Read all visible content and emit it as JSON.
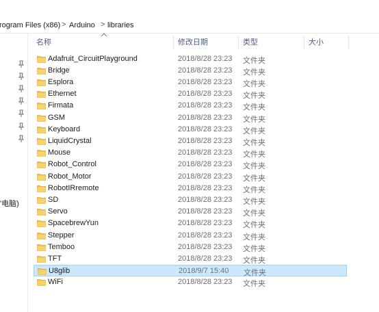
{
  "address": {
    "crumbs": [
      "rogram Files (x86)",
      "Arduino",
      "libraries"
    ],
    "separator": ">"
  },
  "nav": {
    "pins": 7,
    "partial_label": "'电脑)"
  },
  "columns": {
    "name": "名称",
    "modified": "修改日期",
    "type": "类型",
    "size": "大小"
  },
  "files": [
    {
      "name": "Adafruit_CircuitPlayground",
      "modified": "2018/8/28 23:23",
      "type": "文件夹"
    },
    {
      "name": "Bridge",
      "modified": "2018/8/28 23:23",
      "type": "文件夹"
    },
    {
      "name": "Esplora",
      "modified": "2018/8/28 23:23",
      "type": "文件夹"
    },
    {
      "name": "Ethernet",
      "modified": "2018/8/28 23:23",
      "type": "文件夹"
    },
    {
      "name": "Firmata",
      "modified": "2018/8/28 23:23",
      "type": "文件夹"
    },
    {
      "name": "GSM",
      "modified": "2018/8/28 23:23",
      "type": "文件夹"
    },
    {
      "name": "Keyboard",
      "modified": "2018/8/28 23:23",
      "type": "文件夹"
    },
    {
      "name": "LiquidCrystal",
      "modified": "2018/8/28 23:23",
      "type": "文件夹"
    },
    {
      "name": "Mouse",
      "modified": "2018/8/28 23:23",
      "type": "文件夹"
    },
    {
      "name": "Robot_Control",
      "modified": "2018/8/28 23:23",
      "type": "文件夹"
    },
    {
      "name": "Robot_Motor",
      "modified": "2018/8/28 23:23",
      "type": "文件夹"
    },
    {
      "name": "RobotIRremote",
      "modified": "2018/8/28 23:23",
      "type": "文件夹"
    },
    {
      "name": "SD",
      "modified": "2018/8/28 23:23",
      "type": "文件夹"
    },
    {
      "name": "Servo",
      "modified": "2018/8/28 23:23",
      "type": "文件夹"
    },
    {
      "name": "SpacebrewYun",
      "modified": "2018/8/28 23:23",
      "type": "文件夹"
    },
    {
      "name": "Stepper",
      "modified": "2018/8/28 23:23",
      "type": "文件夹"
    },
    {
      "name": "Temboo",
      "modified": "2018/8/28 23:23",
      "type": "文件夹"
    },
    {
      "name": "TFT",
      "modified": "2018/8/28 23:23",
      "type": "文件夹"
    },
    {
      "name": "U8glib",
      "modified": "2018/9/7 15:40",
      "type": "文件夹",
      "selected": true
    },
    {
      "name": "WiFi",
      "modified": "2018/8/28 23:23",
      "type": "文件夹"
    }
  ],
  "colors": {
    "folder": "#f1c24d",
    "selection": "#cce8ff",
    "selection_border": "#99d1ff",
    "header_text": "#4d6082"
  },
  "icons": {
    "folder": "folder-icon",
    "pin": "pin-icon",
    "sort": "sort-up-icon",
    "separator": "chevron-right-icon"
  }
}
